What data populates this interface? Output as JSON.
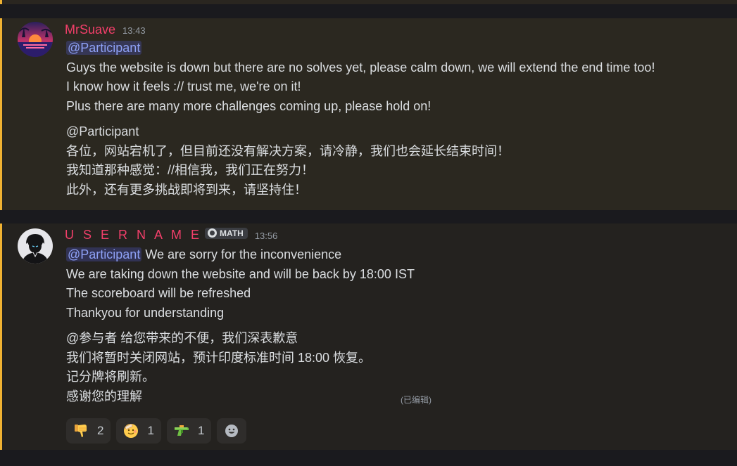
{
  "messages": [
    {
      "author": "MrSuave",
      "time": "13:43",
      "mention": "@Participant",
      "lines_en": [
        "Guys the website is down but there are no solves yet, please calm down, we will extend the end time too!",
        "I know how it feels :// trust me, we're on it!",
        "Plus there are many more challenges coming up, please hold on!"
      ],
      "mention_cn": "@Participant",
      "lines_cn": [
        "各位，网站宕机了，但目前还没有解决方案，请冷静，我们也会延长结束时间！",
        "我知道那种感觉：//相信我，我们正在努力！",
        "此外，还有更多挑战即将到来，请坚持住！"
      ]
    },
    {
      "author": "U S E R N A M E",
      "badge": "MATH",
      "time": "13:56",
      "mention": "@Participant",
      "first_line_rest": " We are sorry for the inconvenience",
      "lines_en": [
        "We are taking down the website and will be back by 18:00 IST",
        "The scoreboard will be refreshed",
        "Thankyou for understanding"
      ],
      "lines_cn": [
        "@参与者 给您带来的不便，我们深表歉意",
        "我们将暂时关闭网站，预计印度标准时间 18:00 恢复。",
        "记分牌将刷新。",
        "感谢您的理解"
      ],
      "edited": "(已编辑)",
      "reactions": [
        {
          "emoji": "thumbs-down",
          "count": "2"
        },
        {
          "emoji": "smiling-face-with-bandage",
          "count": "1"
        },
        {
          "emoji": "water-pistol",
          "count": "1"
        }
      ]
    }
  ],
  "colors": {
    "accent": "#f0b232",
    "username": "#f23f6a",
    "mention_text": "#8ea1f6"
  }
}
